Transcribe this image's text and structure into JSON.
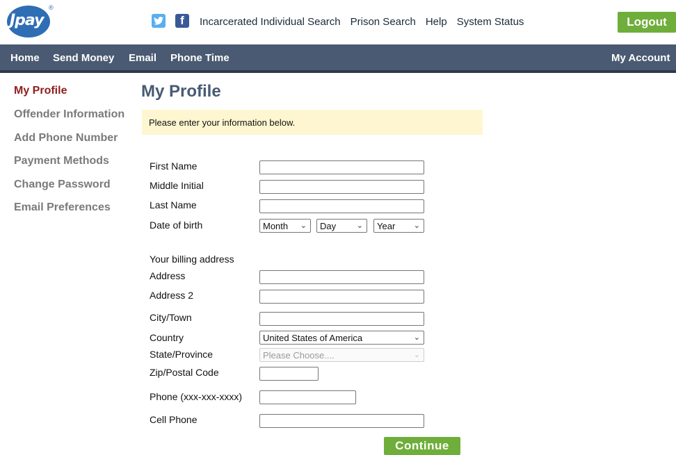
{
  "brand": {
    "logo_text": "Jpay",
    "registered_mark": "®"
  },
  "social": {
    "twitter_glyph": "🐦",
    "facebook_glyph": "f"
  },
  "top_links": [
    "Incarcerated Individual Search",
    "Prison Search",
    "Help",
    "System Status"
  ],
  "logout_label": "Logout",
  "nav": {
    "items": [
      "Home",
      "Send Money",
      "Email",
      "Phone Time"
    ],
    "account": "My Account"
  },
  "sidebar": {
    "items": [
      "My Profile",
      "Offender Information",
      "Add Phone Number",
      "Payment Methods",
      "Change Password",
      "Email Preferences"
    ],
    "active": "My Profile"
  },
  "page_title": "My Profile",
  "notice": "Please enter your information below.",
  "form": {
    "first_name_label": "First Name",
    "middle_initial_label": "Middle Initial",
    "last_name_label": "Last Name",
    "dob_label": "Date of birth",
    "dob_month": "Month",
    "dob_day": "Day",
    "dob_year": "Year",
    "billing_heading": "Your billing address",
    "address_label": "Address",
    "address2_label": "Address 2",
    "city_label": "City/Town",
    "country_label": "Country",
    "country_value": "United States of America",
    "state_label": "State/Province",
    "state_placeholder": "Please Choose....",
    "zip_label": "Zip/Postal Code",
    "phone_label": "Phone (xxx-xxx-xxxx)",
    "cell_label": "Cell Phone",
    "continue_label": "Continue"
  },
  "colors": {
    "brand_blue": "#2f6db5",
    "nav_bg": "#4a5a72",
    "accent_green": "#6fae3a",
    "active_red": "#8e1e1e",
    "notice_bg": "#fdf6d0"
  }
}
